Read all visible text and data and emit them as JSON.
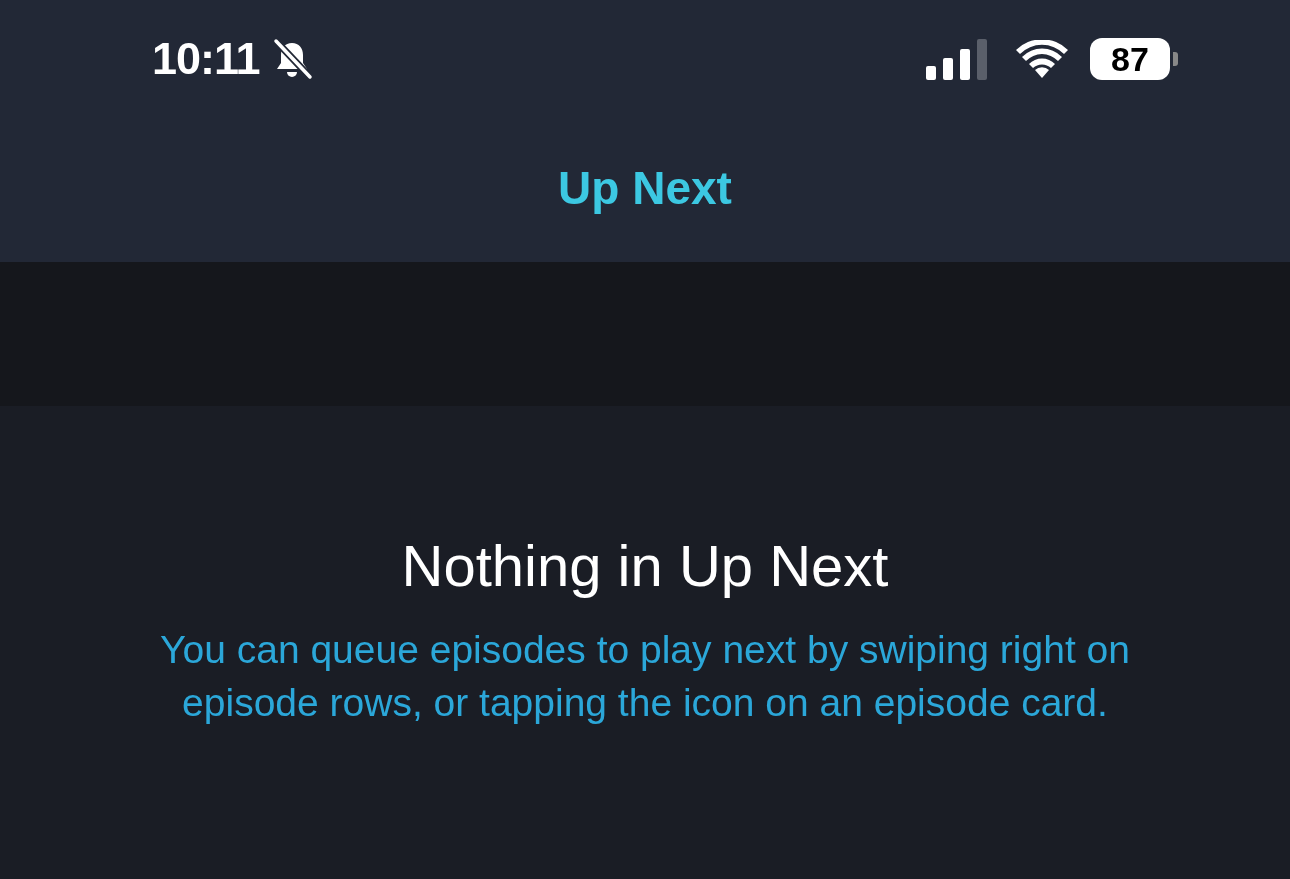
{
  "status_bar": {
    "time": "10:11",
    "battery": "87"
  },
  "nav_bar": {
    "title": "Up Next"
  },
  "empty_state": {
    "title": "Nothing in Up Next",
    "message": "You can queue episodes to play next by swiping right on episode rows, or tapping the icon on an episode card."
  }
}
